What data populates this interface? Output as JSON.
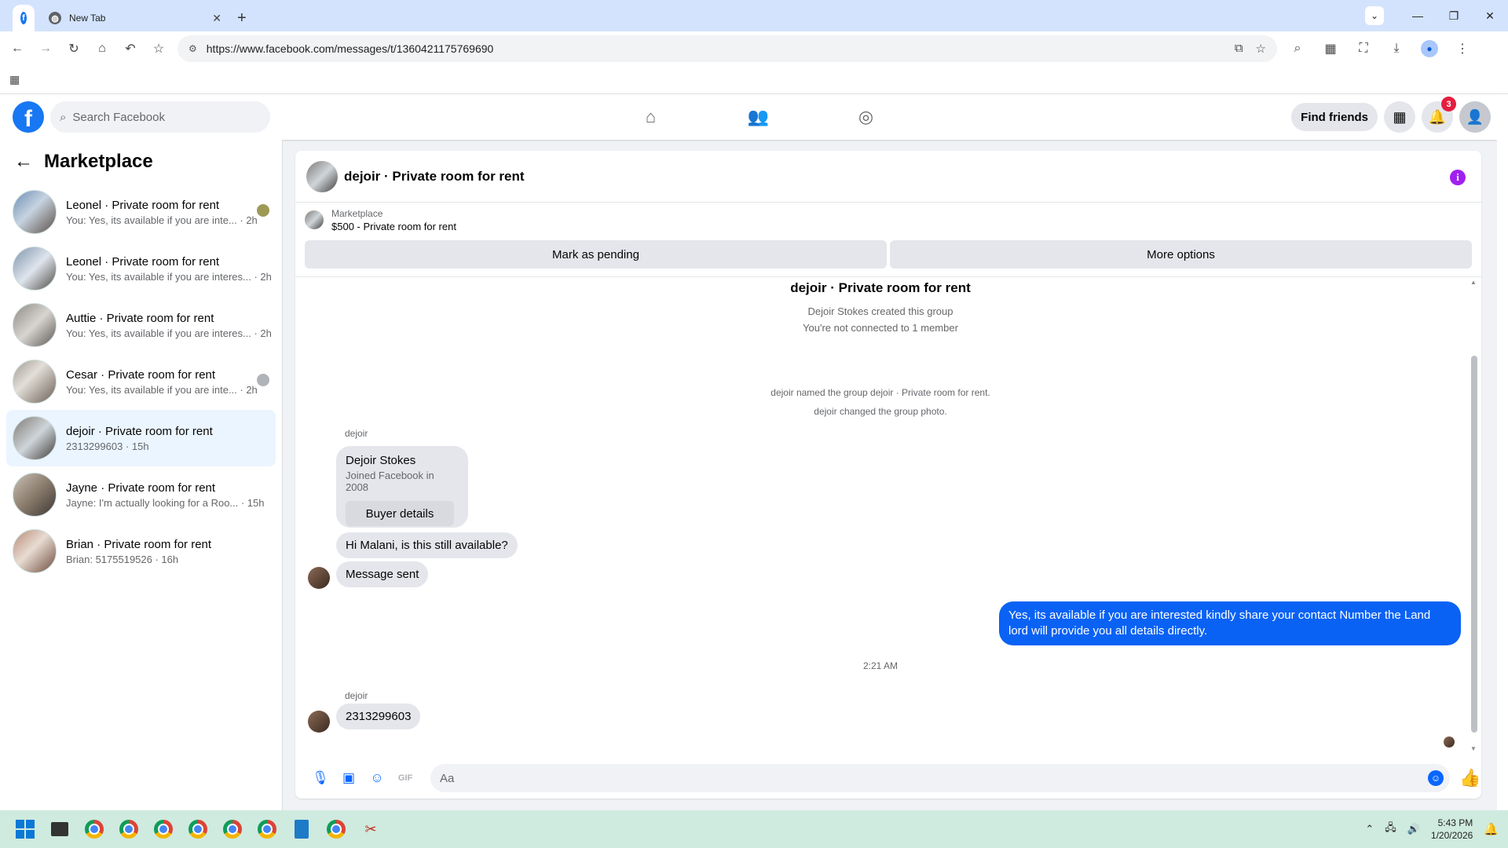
{
  "browser": {
    "tabs": [
      {
        "title": "",
        "icon": "facebook-icon",
        "active": true
      },
      {
        "title": "New Tab",
        "icon": "globe-icon",
        "active": false
      }
    ],
    "url": "https://www.facebook.com/messages/t/1360421175769690"
  },
  "header": {
    "search_placeholder": "Search Facebook",
    "find_friends_label": "Find friends",
    "notification_count": "3"
  },
  "sidebar": {
    "title": "Marketplace",
    "conversations": [
      {
        "name": "Leonel · Private room for rent",
        "snippet": "You: Yes, its available if you are inte... · 2h"
      },
      {
        "name": "Leonel · Private room for rent",
        "snippet": "You: Yes, its available if you are interes... · 2h"
      },
      {
        "name": "Auttie · Private room for rent",
        "snippet": "You: Yes, its available if you are interes... · 2h"
      },
      {
        "name": "Cesar · Private room for rent",
        "snippet": "You: Yes, its available if you are inte... · 2h"
      },
      {
        "name": "dejoir · Private room for rent",
        "snippet": "2313299603 · 15h"
      },
      {
        "name": "Jayne · Private room for rent",
        "snippet": "Jayne: I'm actually looking for a Roo... · 15h"
      },
      {
        "name": "Brian · Private room for rent",
        "snippet": "Brian: 5175519526 · 16h"
      }
    ]
  },
  "chat": {
    "title": "dejoir · Private room for rent",
    "listing_label": "Marketplace",
    "listing_price": "$500 - Private room for rent",
    "mark_pending_label": "Mark as pending",
    "more_options_label": "More options",
    "group_title": "dejoir · Private room for rent",
    "created_text": "Dejoir Stokes created this group",
    "connected_text": "You're not connected to 1 member",
    "named_event": "dejoir named the group dejoir · Private room for rent.",
    "photo_event": "dejoir changed the group photo.",
    "sender_1": "dejoir",
    "buyer_name": "Dejoir Stokes",
    "buyer_joined": "Joined Facebook in 2008",
    "buyer_details_label": "Buyer details",
    "msg_1": "Hi Malani, is this still available?",
    "msg_2": "Message sent",
    "msg_out": "Yes, its available if you are interested kindly share your contact Number the Land lord will provide you all details directly.",
    "time_divider": "2:21 AM",
    "sender_2": "dejoir",
    "msg_3": "2313299603",
    "composer_placeholder": "Aa",
    "accent_color": "#0a62f4"
  },
  "taskbar": {
    "time": "5:43 PM",
    "date": "1/20/2026"
  }
}
